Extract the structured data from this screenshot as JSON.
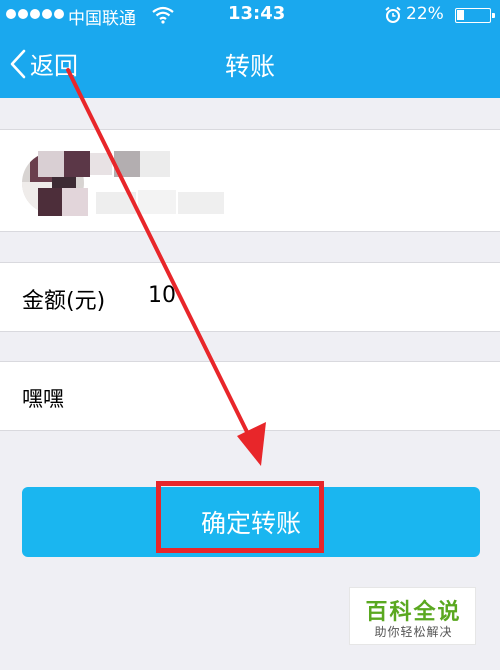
{
  "status_bar": {
    "carrier": "中国联通",
    "time": "13:43",
    "battery": "22%"
  },
  "nav": {
    "back_label": "返回",
    "title": "转账"
  },
  "transfer": {
    "amount_label": "金额(元)",
    "amount_value": "10",
    "note": "嘿嘿"
  },
  "actions": {
    "confirm_label": "确定转账"
  },
  "watermark": {
    "title": "百科全说",
    "subtitle": "助你轻松解决"
  },
  "colors": {
    "nav_bar": "#1aa8ee",
    "confirm_button": "#1ab6f0",
    "annotation": "#e8262a",
    "watermark_text": "#5aa820"
  },
  "icons": {
    "back": "chevron-left-icon",
    "wifi": "wifi-icon",
    "alarm": "alarm-icon",
    "battery": "battery-icon"
  }
}
